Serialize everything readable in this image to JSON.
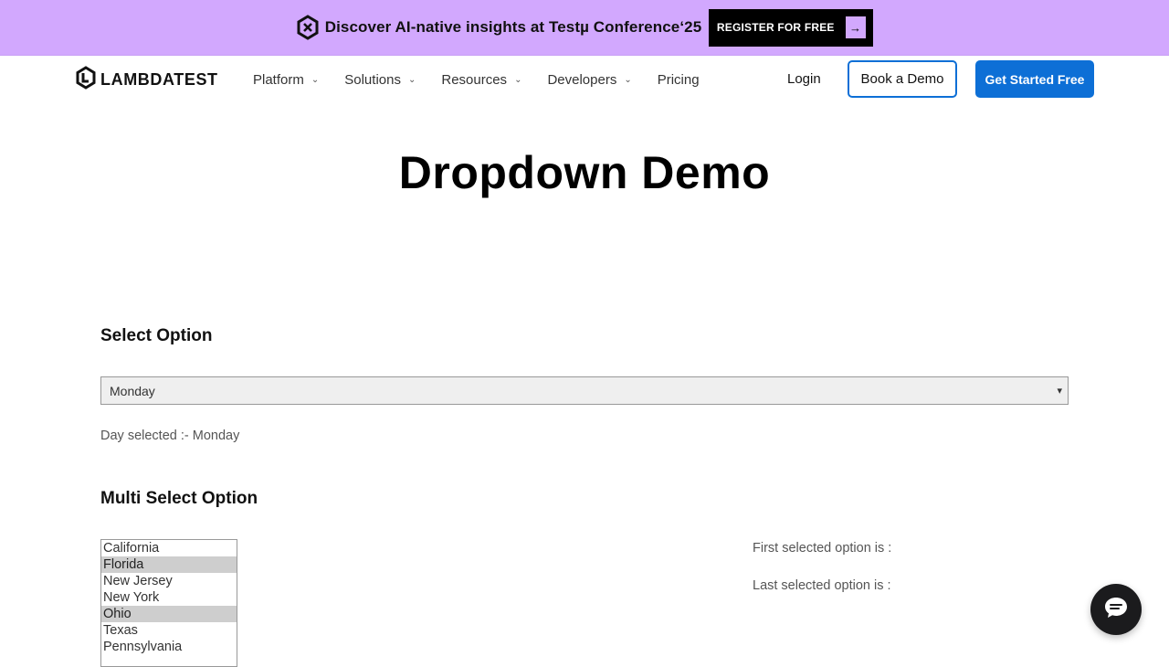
{
  "promo": {
    "text": "Discover AI-native insights at Testµ Conference‘25",
    "button_label": "REGISTER FOR FREE",
    "background": "#d2a8fe"
  },
  "nav": {
    "brand": "LAMBDATEST",
    "items": [
      {
        "label": "Platform",
        "has_dropdown": true
      },
      {
        "label": "Solutions",
        "has_dropdown": true
      },
      {
        "label": "Resources",
        "has_dropdown": true
      },
      {
        "label": "Developers",
        "has_dropdown": true
      },
      {
        "label": "Pricing",
        "has_dropdown": false
      }
    ],
    "login": "Login",
    "book_demo": "Book a Demo",
    "get_started": "Get Started Free",
    "accent": "#0d6fd6"
  },
  "page": {
    "title": "Dropdown Demo"
  },
  "single_select": {
    "heading": "Select Option",
    "value": "Monday",
    "result_text": "Day selected :- Monday"
  },
  "multi_select": {
    "heading": "Multi Select Option",
    "options": [
      {
        "label": "California",
        "selected": false
      },
      {
        "label": "Florida",
        "selected": true
      },
      {
        "label": "New Jersey",
        "selected": false
      },
      {
        "label": "New York",
        "selected": false
      },
      {
        "label": "Ohio",
        "selected": true
      },
      {
        "label": "Texas",
        "selected": false
      },
      {
        "label": "Pennsylvania",
        "selected": false
      }
    ],
    "first_selected_label": "First selected option is :",
    "last_selected_label": "Last selected option is :"
  }
}
